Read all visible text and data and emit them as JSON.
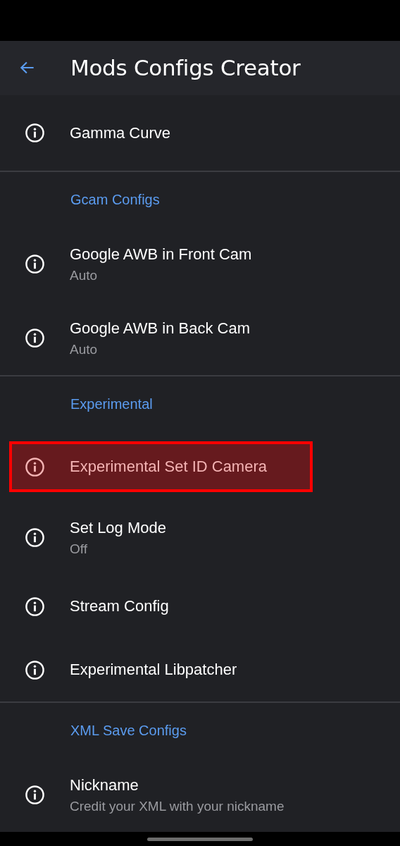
{
  "app_bar": {
    "title": "Mods Configs Creator"
  },
  "sections": [
    {
      "items": [
        {
          "title": "Gamma Curve",
          "highlighted": false
        }
      ]
    },
    {
      "header": "Gcam Configs",
      "items": [
        {
          "title": "Google AWB in Front Cam",
          "summary": "Auto",
          "highlighted": false
        },
        {
          "title": "Google AWB in Back Cam",
          "summary": "Auto",
          "highlighted": false
        }
      ]
    },
    {
      "header": "Experimental",
      "items": [
        {
          "title": "Experimental Set ID Camera",
          "highlighted": true
        },
        {
          "title": "Set Log Mode",
          "summary": "Off",
          "highlighted": false
        },
        {
          "title": "Stream Config",
          "highlighted": false
        },
        {
          "title": "Experimental Libpatcher",
          "highlighted": false
        }
      ]
    },
    {
      "header": "XML Save Configs",
      "items": [
        {
          "title": "Nickname",
          "summary": "Credit your XML with your nickname",
          "highlighted": false
        }
      ]
    }
  ]
}
